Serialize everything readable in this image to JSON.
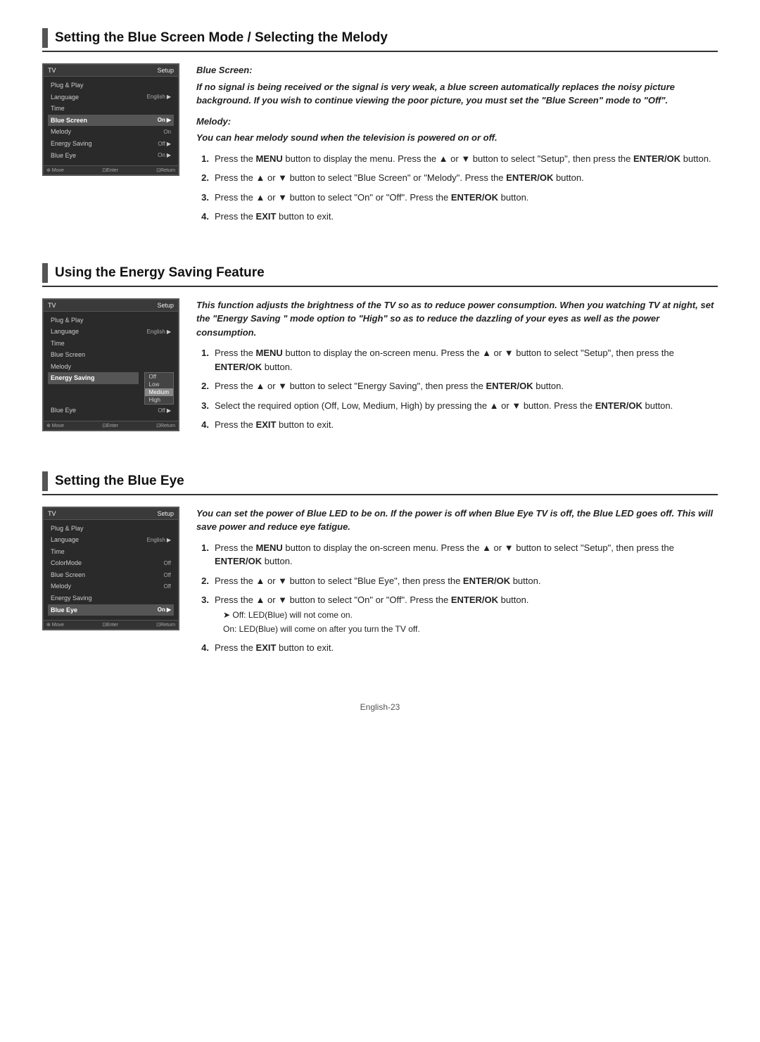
{
  "sections": [
    {
      "id": "blue-screen-melody",
      "title": "Setting the Blue Screen Mode / Selecting the Melody",
      "tv": {
        "title_left": "TV",
        "title_right": "Setup",
        "menu_items": [
          {
            "label": "Plug & Play",
            "value": "",
            "highlighted": false
          },
          {
            "label": "Language",
            "value": "English",
            "highlighted": false,
            "arrow": true
          },
          {
            "label": "Time",
            "value": "",
            "highlighted": false
          },
          {
            "label": "Blue Screen",
            "value": "On",
            "highlighted": true,
            "arrow": true
          },
          {
            "label": "Melody",
            "value": "On",
            "highlighted": false,
            "arrow": false
          },
          {
            "label": "Energy Saving",
            "value": "Off",
            "highlighted": false,
            "arrow": true
          },
          {
            "label": "Blue Eye",
            "value": "On",
            "highlighted": false,
            "arrow": true
          }
        ],
        "footer": [
          "⊕ Move",
          "⊡Enter",
          "⊡Return"
        ]
      },
      "subsections": [
        {
          "id": "blue-screen",
          "heading": "Blue Screen:",
          "intro": "If no signal is being received or the signal is very weak, a blue screen automatically replaces the noisy picture background. If you wish to continue viewing the poor picture, you must set the \"Blue Screen\" mode to \"Off\".",
          "intro_bold": true
        },
        {
          "id": "melody",
          "heading": "Melody:",
          "intro": "You can hear melody sound when the television is powered on or off.",
          "intro_bold": false
        }
      ],
      "steps": [
        {
          "num": "1.",
          "text_parts": [
            {
              "type": "normal",
              "text": "Press the "
            },
            {
              "type": "bold",
              "text": "MENU"
            },
            {
              "type": "normal",
              "text": " button to display the menu. Press the ▲ or ▼ button to select \"Setup\", then press the "
            },
            {
              "type": "bold",
              "text": "ENTER/OK"
            },
            {
              "type": "normal",
              "text": " button."
            }
          ]
        },
        {
          "num": "2.",
          "text_parts": [
            {
              "type": "normal",
              "text": "Press the ▲ or ▼ button to select \"Blue Screen\" or \"Melody\". Press the "
            },
            {
              "type": "bold",
              "text": "ENTER/OK"
            },
            {
              "type": "normal",
              "text": " button."
            }
          ]
        },
        {
          "num": "3.",
          "text_parts": [
            {
              "type": "normal",
              "text": "Press the ▲ or ▼ button to select \"On\" or \"Off\". Press the "
            },
            {
              "type": "bold",
              "text": "ENTER/OK"
            },
            {
              "type": "normal",
              "text": " button."
            }
          ]
        },
        {
          "num": "4.",
          "text_parts": [
            {
              "type": "normal",
              "text": "Press the "
            },
            {
              "type": "bold",
              "text": "EXIT"
            },
            {
              "type": "normal",
              "text": " button to exit."
            }
          ]
        }
      ]
    },
    {
      "id": "energy-saving",
      "title": "Using the Energy Saving Feature",
      "tv": {
        "title_left": "TV",
        "title_right": "Setup",
        "menu_items": [
          {
            "label": "Plug & Play",
            "value": "",
            "highlighted": false
          },
          {
            "label": "Language",
            "value": "English",
            "highlighted": false,
            "arrow": true
          },
          {
            "label": "Time",
            "value": "",
            "highlighted": false
          },
          {
            "label": "Blue Screen",
            "value": "",
            "highlighted": false
          },
          {
            "label": "Melody",
            "value": "",
            "highlighted": false
          },
          {
            "label": "Energy Saving",
            "value": "",
            "highlighted": true,
            "arrow": true,
            "has_dropdown": true
          },
          {
            "label": "Blue Eye",
            "value": "Off",
            "highlighted": false,
            "arrow": true
          }
        ],
        "dropdown_items": [
          {
            "label": "Off",
            "active": false
          },
          {
            "label": "Low",
            "active": false
          },
          {
            "label": "Medium",
            "active": true
          },
          {
            "label": "High",
            "active": false
          }
        ],
        "footer": [
          "⊕ Move",
          "⊡Enter",
          "⊡Return"
        ]
      },
      "intro_bold": "This function adjusts the brightness of the TV so as to reduce power consumption. When you watching TV at night, set the  \"Energy Saving \" mode option to \"High\" so as to reduce the dazzling of your eyes as well as the power consumption.",
      "steps": [
        {
          "num": "1.",
          "text_parts": [
            {
              "type": "normal",
              "text": "Press the "
            },
            {
              "type": "bold",
              "text": "MENU"
            },
            {
              "type": "normal",
              "text": " button to display the on-screen menu. Press the ▲ or ▼ button to select \"Setup\", then press the "
            },
            {
              "type": "bold",
              "text": "ENTER/OK"
            },
            {
              "type": "normal",
              "text": " button."
            }
          ]
        },
        {
          "num": "2.",
          "text_parts": [
            {
              "type": "normal",
              "text": "Press the ▲ or ▼ button to select \"Energy Saving\", then press the "
            },
            {
              "type": "bold",
              "text": "ENTER/OK"
            },
            {
              "type": "normal",
              "text": " button."
            }
          ]
        },
        {
          "num": "3.",
          "text_parts": [
            {
              "type": "normal",
              "text": "Select the required option (Off, Low, Medium, High) by pressing the ▲ or ▼ button. Press the "
            },
            {
              "type": "bold",
              "text": "ENTER/OK"
            },
            {
              "type": "normal",
              "text": " button."
            }
          ]
        },
        {
          "num": "4.",
          "text_parts": [
            {
              "type": "normal",
              "text": "Press the "
            },
            {
              "type": "bold",
              "text": "EXIT"
            },
            {
              "type": "normal",
              "text": " button to exit."
            }
          ]
        }
      ]
    },
    {
      "id": "blue-eye",
      "title": "Setting the Blue Eye",
      "tv": {
        "title_left": "TV",
        "title_right": "Setup",
        "menu_items": [
          {
            "label": "Plug & Play",
            "value": "",
            "highlighted": false
          },
          {
            "label": "Language",
            "value": "English",
            "highlighted": false,
            "arrow": true
          },
          {
            "label": "Time",
            "value": "",
            "highlighted": false
          },
          {
            "label": "ColorMode",
            "value": "Off",
            "highlighted": false
          },
          {
            "label": "Blue Screen",
            "value": "Off",
            "highlighted": false
          },
          {
            "label": "Melody",
            "value": "Off",
            "highlighted": false
          },
          {
            "label": "Energy Saving",
            "value": "",
            "highlighted": false
          },
          {
            "label": "Blue Eye",
            "value": "On",
            "highlighted": true,
            "arrow": true
          }
        ],
        "footer": [
          "⊕ Move",
          "⊡Enter",
          "⊡Return"
        ]
      },
      "intro_bold": "You can set the power of Blue LED to be on. If the power is off when Blue Eye TV is off, the Blue LED goes off. This will save power and reduce eye fatigue.",
      "steps": [
        {
          "num": "1.",
          "text_parts": [
            {
              "type": "normal",
              "text": "Press the "
            },
            {
              "type": "bold",
              "text": "MENU"
            },
            {
              "type": "normal",
              "text": " button to display the on-screen menu. Press the ▲ or ▼ button to select \"Setup\", then press the "
            },
            {
              "type": "bold",
              "text": "ENTER/OK"
            },
            {
              "type": "normal",
              "text": " button."
            }
          ]
        },
        {
          "num": "2.",
          "text_parts": [
            {
              "type": "normal",
              "text": "Press the ▲ or ▼ button to select \"Blue Eye\", then press the "
            },
            {
              "type": "bold",
              "text": "ENTER/OK"
            },
            {
              "type": "normal",
              "text": " button."
            }
          ]
        },
        {
          "num": "3.",
          "text_parts": [
            {
              "type": "normal",
              "text": "Press the ▲ or ▼ button to select \"On\" or \"Off\". Press the "
            },
            {
              "type": "bold",
              "text": "ENTER/OK"
            },
            {
              "type": "normal",
              "text": " button."
            }
          ],
          "subnotes": [
            {
              "prefix": "➤",
              "text": " Off: LED(Blue) will not come on."
            },
            {
              "prefix": "",
              "text": "On: LED(Blue) will come on after you turn the TV off."
            }
          ]
        },
        {
          "num": "4.",
          "text_parts": [
            {
              "type": "normal",
              "text": "Press the "
            },
            {
              "type": "bold",
              "text": "EXIT"
            },
            {
              "type": "normal",
              "text": " button to exit."
            }
          ]
        }
      ]
    }
  ],
  "footer": {
    "page": "English-23"
  }
}
